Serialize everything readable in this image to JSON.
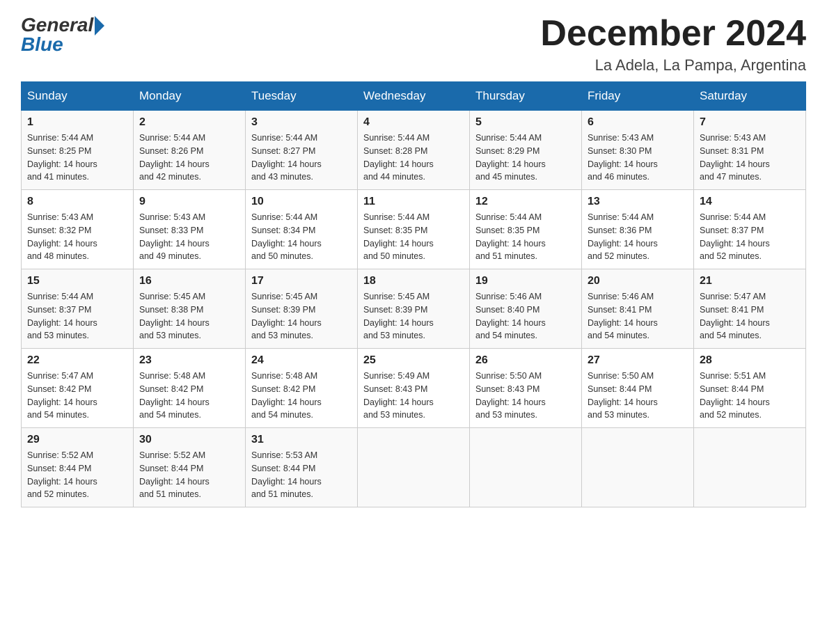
{
  "header": {
    "logo_general": "General",
    "logo_blue": "Blue",
    "month_title": "December 2024",
    "location": "La Adela, La Pampa, Argentina"
  },
  "days_of_week": [
    "Sunday",
    "Monday",
    "Tuesday",
    "Wednesday",
    "Thursday",
    "Friday",
    "Saturday"
  ],
  "weeks": [
    [
      {
        "day": "1",
        "sunrise": "5:44 AM",
        "sunset": "8:25 PM",
        "daylight": "14 hours and 41 minutes."
      },
      {
        "day": "2",
        "sunrise": "5:44 AM",
        "sunset": "8:26 PM",
        "daylight": "14 hours and 42 minutes."
      },
      {
        "day": "3",
        "sunrise": "5:44 AM",
        "sunset": "8:27 PM",
        "daylight": "14 hours and 43 minutes."
      },
      {
        "day": "4",
        "sunrise": "5:44 AM",
        "sunset": "8:28 PM",
        "daylight": "14 hours and 44 minutes."
      },
      {
        "day": "5",
        "sunrise": "5:44 AM",
        "sunset": "8:29 PM",
        "daylight": "14 hours and 45 minutes."
      },
      {
        "day": "6",
        "sunrise": "5:43 AM",
        "sunset": "8:30 PM",
        "daylight": "14 hours and 46 minutes."
      },
      {
        "day": "7",
        "sunrise": "5:43 AM",
        "sunset": "8:31 PM",
        "daylight": "14 hours and 47 minutes."
      }
    ],
    [
      {
        "day": "8",
        "sunrise": "5:43 AM",
        "sunset": "8:32 PM",
        "daylight": "14 hours and 48 minutes."
      },
      {
        "day": "9",
        "sunrise": "5:43 AM",
        "sunset": "8:33 PM",
        "daylight": "14 hours and 49 minutes."
      },
      {
        "day": "10",
        "sunrise": "5:44 AM",
        "sunset": "8:34 PM",
        "daylight": "14 hours and 50 minutes."
      },
      {
        "day": "11",
        "sunrise": "5:44 AM",
        "sunset": "8:35 PM",
        "daylight": "14 hours and 50 minutes."
      },
      {
        "day": "12",
        "sunrise": "5:44 AM",
        "sunset": "8:35 PM",
        "daylight": "14 hours and 51 minutes."
      },
      {
        "day": "13",
        "sunrise": "5:44 AM",
        "sunset": "8:36 PM",
        "daylight": "14 hours and 52 minutes."
      },
      {
        "day": "14",
        "sunrise": "5:44 AM",
        "sunset": "8:37 PM",
        "daylight": "14 hours and 52 minutes."
      }
    ],
    [
      {
        "day": "15",
        "sunrise": "5:44 AM",
        "sunset": "8:37 PM",
        "daylight": "14 hours and 53 minutes."
      },
      {
        "day": "16",
        "sunrise": "5:45 AM",
        "sunset": "8:38 PM",
        "daylight": "14 hours and 53 minutes."
      },
      {
        "day": "17",
        "sunrise": "5:45 AM",
        "sunset": "8:39 PM",
        "daylight": "14 hours and 53 minutes."
      },
      {
        "day": "18",
        "sunrise": "5:45 AM",
        "sunset": "8:39 PM",
        "daylight": "14 hours and 53 minutes."
      },
      {
        "day": "19",
        "sunrise": "5:46 AM",
        "sunset": "8:40 PM",
        "daylight": "14 hours and 54 minutes."
      },
      {
        "day": "20",
        "sunrise": "5:46 AM",
        "sunset": "8:41 PM",
        "daylight": "14 hours and 54 minutes."
      },
      {
        "day": "21",
        "sunrise": "5:47 AM",
        "sunset": "8:41 PM",
        "daylight": "14 hours and 54 minutes."
      }
    ],
    [
      {
        "day": "22",
        "sunrise": "5:47 AM",
        "sunset": "8:42 PM",
        "daylight": "14 hours and 54 minutes."
      },
      {
        "day": "23",
        "sunrise": "5:48 AM",
        "sunset": "8:42 PM",
        "daylight": "14 hours and 54 minutes."
      },
      {
        "day": "24",
        "sunrise": "5:48 AM",
        "sunset": "8:42 PM",
        "daylight": "14 hours and 54 minutes."
      },
      {
        "day": "25",
        "sunrise": "5:49 AM",
        "sunset": "8:43 PM",
        "daylight": "14 hours and 53 minutes."
      },
      {
        "day": "26",
        "sunrise": "5:50 AM",
        "sunset": "8:43 PM",
        "daylight": "14 hours and 53 minutes."
      },
      {
        "day": "27",
        "sunrise": "5:50 AM",
        "sunset": "8:44 PM",
        "daylight": "14 hours and 53 minutes."
      },
      {
        "day": "28",
        "sunrise": "5:51 AM",
        "sunset": "8:44 PM",
        "daylight": "14 hours and 52 minutes."
      }
    ],
    [
      {
        "day": "29",
        "sunrise": "5:52 AM",
        "sunset": "8:44 PM",
        "daylight": "14 hours and 52 minutes."
      },
      {
        "day": "30",
        "sunrise": "5:52 AM",
        "sunset": "8:44 PM",
        "daylight": "14 hours and 51 minutes."
      },
      {
        "day": "31",
        "sunrise": "5:53 AM",
        "sunset": "8:44 PM",
        "daylight": "14 hours and 51 minutes."
      },
      null,
      null,
      null,
      null
    ]
  ],
  "labels": {
    "sunrise": "Sunrise: ",
    "sunset": "Sunset: ",
    "daylight": "Daylight: "
  }
}
